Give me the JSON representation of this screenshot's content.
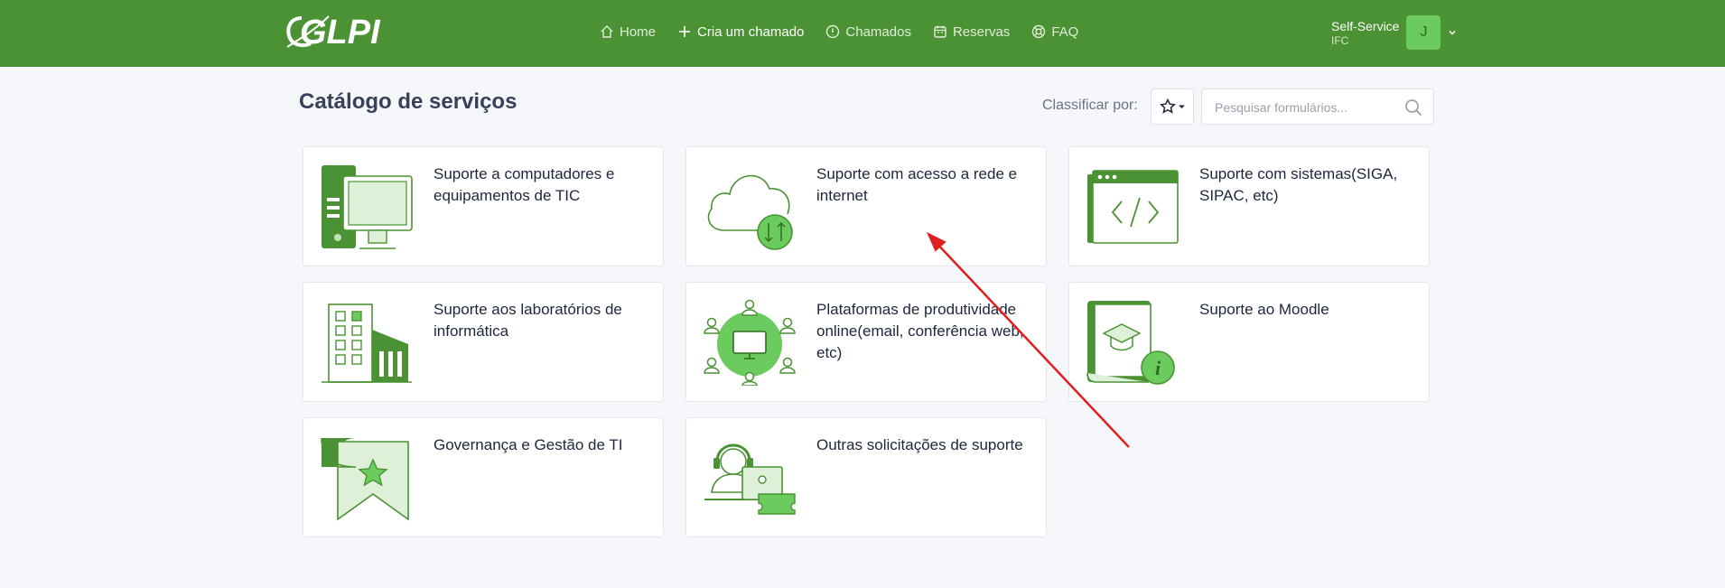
{
  "app": {
    "logo_text": "GLPI"
  },
  "nav": {
    "items": [
      {
        "label": "Home",
        "icon": "home-icon"
      },
      {
        "label": "Cria um chamado",
        "icon": "plus-icon"
      },
      {
        "label": "Chamados",
        "icon": "alert-circle-icon"
      },
      {
        "label": "Reservas",
        "icon": "calendar-icon"
      },
      {
        "label": "FAQ",
        "icon": "lifebuoy-icon"
      }
    ]
  },
  "user": {
    "profile": "Self-Service",
    "entity": "IFC",
    "initial": "J"
  },
  "page": {
    "title": "Catálogo de serviços",
    "sort_label": "Classificar por:",
    "search_placeholder": "Pesquisar formulários..."
  },
  "cards": [
    {
      "label": "Suporte a computadores e equipamentos de TIC",
      "icon": "computer-icon"
    },
    {
      "label": "Suporte com acesso a rede e internet",
      "icon": "cloud-network-icon"
    },
    {
      "label": "Suporte com sistemas(SIGA, SIPAC, etc)",
      "icon": "code-window-icon"
    },
    {
      "label": "Suporte aos laboratórios de informática",
      "icon": "building-icon"
    },
    {
      "label": "Plataformas de produtividade online(email, conferência web, etc)",
      "icon": "collaboration-icon"
    },
    {
      "label": "Suporte ao Moodle",
      "icon": "moodle-book-icon"
    },
    {
      "label": "Governança e Gestão de TI",
      "icon": "award-ribbon-icon"
    },
    {
      "label": "Outras solicitações de suporte",
      "icon": "support-agent-icon"
    }
  ],
  "colors": {
    "brand": "#4a9233",
    "accent_light": "#6ccb5f",
    "arrow": "#e02020"
  }
}
